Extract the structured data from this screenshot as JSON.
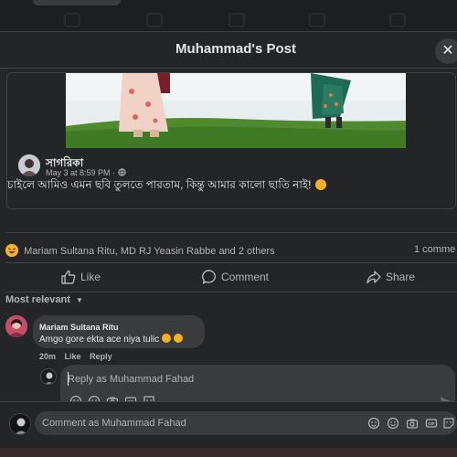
{
  "modal": {
    "title": "Muhammad's Post",
    "close_icon": "close-icon"
  },
  "shared_post": {
    "author": "সাগরিকা",
    "timestamp": "May 3 at 8:59 PM ·",
    "privacy_icon": "globe-icon",
    "text": "চাইলে আমিও এমন ছবি তুলতে পারতাম, কিন্তু আমার কালো ছাতি নাই!"
  },
  "reactions": {
    "summary": "Mariam Sultana Ritu, MD RJ Yeasin Rabbe and 2 others",
    "comment_count": "1 comme"
  },
  "actions": {
    "like": "Like",
    "comment": "Comment",
    "share": "Share"
  },
  "sort": {
    "label": "Most relevant"
  },
  "comment": {
    "author": "Mariam Sultana Ritu",
    "text": "Amgo gore ekta ace niya tulic",
    "time": "20m",
    "like": "Like",
    "reply": "Reply"
  },
  "reply_box": {
    "placeholder": "Reply as Muhammad Fahad"
  },
  "composer": {
    "placeholder": "Comment as Muhammad Fahad"
  },
  "colors": {
    "background": "#242526",
    "bubble": "#3a3b3c",
    "text_primary": "#e4e6eb",
    "text_secondary": "#b0b3b8",
    "comment_border": "#2d88ff"
  }
}
